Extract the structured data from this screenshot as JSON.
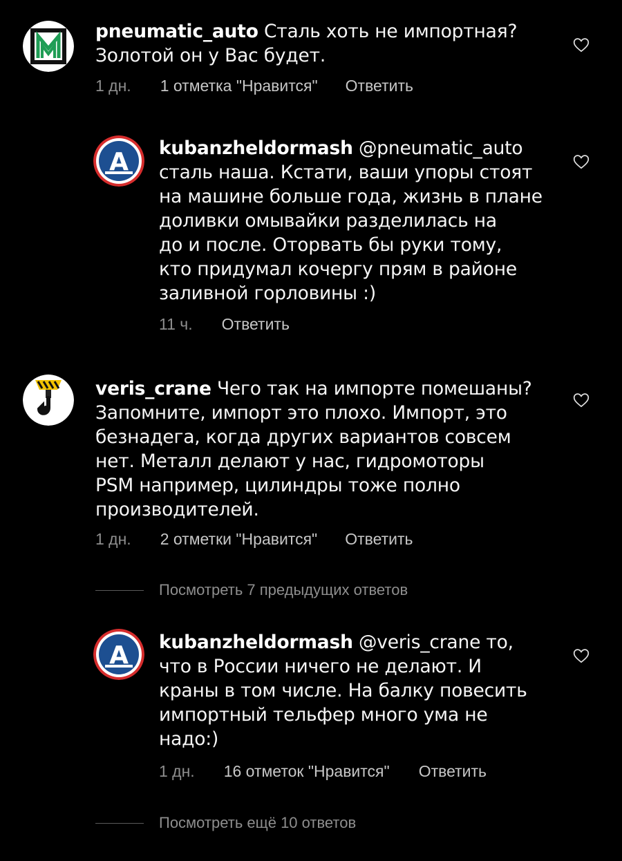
{
  "colors": {
    "background": "#000000",
    "text": "#f5f5f5",
    "meta": "#a8a8a8",
    "avatar_blue": "#1d4f91",
    "avatar_green": "#1f9d55"
  },
  "comments": [
    {
      "username": "pneumatic_auto",
      "text": "Сталь хоть не импортная?\nЗолотой он у Вас будет.",
      "time": "1 дн.",
      "likes": "1 отметка \"Нравится\"",
      "reply": "Ответить",
      "avatar_icon": "pneumatic-logo-icon"
    },
    {
      "username": "kubanzheldormash",
      "mention": "@pneumatic_auto",
      "text": "сталь наша. Кстати, ваши упоры стоят\nна машине больше года, жизнь в плане\nдоливки омывайки разделилась на\nдо и после. Оторвать бы руки тому,\nкто придумал кочергу прям в районе\nзаливной горловины :)",
      "time": "11 ч.",
      "reply": "Ответить",
      "avatar_icon": "kubanzheldormash-logo-icon"
    },
    {
      "username": "veris_crane",
      "text": "Чего так на импорте помешаны?\nЗапомните, импорт это плохо. Импорт, это\nбезнадега, когда других вариантов совсем\nнет. Металл делают у нас, гидромоторы\nPSM например, цилиндры тоже полно\nпроизводителей.",
      "time": "1 дн.",
      "likes": "2 отметки \"Нравится\"",
      "reply": "Ответить",
      "avatar_icon": "crane-hook-icon"
    },
    {
      "username": "kubanzheldormash",
      "mention": "@veris_crane",
      "text": "то,\nчто в России ничего не делают. И\nкраны в том числе. На балку повесить\nимпортный тельфер много ума не\nнадо:)",
      "time": "1 дн.",
      "likes": "16 отметок \"Нравится\"",
      "reply": "Ответить",
      "avatar_icon": "kubanzheldormash-logo-icon"
    }
  ],
  "view_previous": "Посмотреть 7 предыдущих ответов",
  "view_more": "Посмотреть ещё 10 ответов",
  "avatar_letter": "А"
}
